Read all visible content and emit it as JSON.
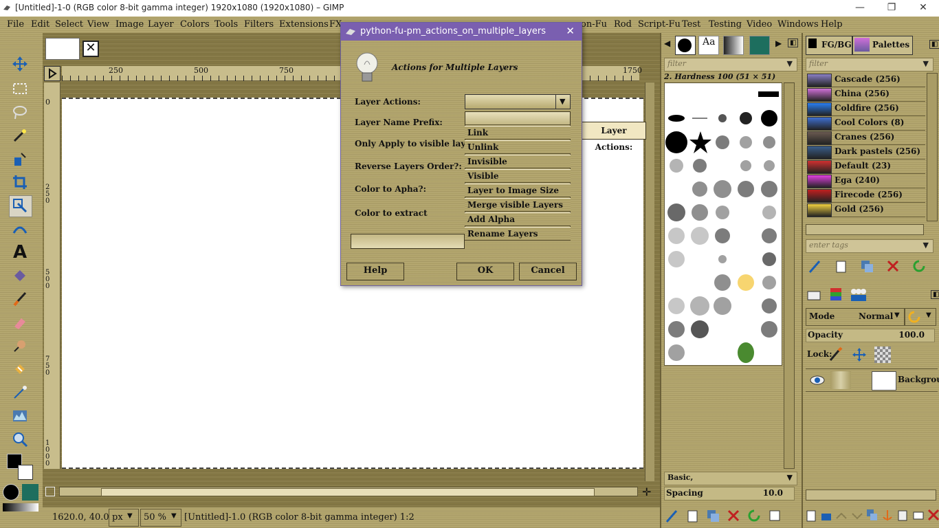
{
  "window": {
    "title": "[Untitled]-1-0 (RGB color 8-bit gamma integer) 1920x1080 (1920x1080) – GIMP",
    "controls": [
      "—",
      "❐",
      "✕"
    ]
  },
  "menubar": [
    "File",
    "Edit",
    "Select",
    "View",
    "Image",
    "Layer",
    "Colors",
    "Tools",
    "Filters",
    "Extensions",
    "FX",
    "on-Fu",
    "Rod",
    "Script-Fu",
    "Test",
    "Testing",
    "Video",
    "Windows",
    "Help"
  ],
  "ruler": {
    "h_ticks": [
      "250",
      "500",
      "750",
      "1750"
    ],
    "v_ticks": [
      "0",
      "250",
      "500",
      "750",
      "1000"
    ]
  },
  "status": {
    "coords": "1620.0, 40.0",
    "unit": "px",
    "zoom": "50 %",
    "info": "[Untitled]-1.0 (RGB color 8-bit gamma integer) 1:2"
  },
  "brushes": {
    "filter_placeholder": "filter",
    "selected": "2. Hardness 100 (51 × 51)",
    "preset": "Basic,",
    "spacing_label": "Spacing",
    "spacing_value": "10.0"
  },
  "palettes": {
    "tab_fgbg": "FG/BG",
    "tab_palettes": "Palettes",
    "filter_placeholder": "filter",
    "tags_placeholder": "enter tags",
    "items": [
      {
        "name": "Cascade (256)",
        "color": "#8a7fc4"
      },
      {
        "name": "China (256)",
        "color": "#d070d8"
      },
      {
        "name": "Coldfire (256)",
        "color": "#2a7ef0"
      },
      {
        "name": "Cool Colors (8)",
        "color": "#3f6fd0"
      },
      {
        "name": "Cranes (256)",
        "color": "#6a5a50"
      },
      {
        "name": "Dark pastels (256)",
        "color": "#3a5d8a"
      },
      {
        "name": "Default (23)",
        "color": "#d03030"
      },
      {
        "name": "Ega (240)",
        "color": "#e040e0"
      },
      {
        "name": "Firecode (256)",
        "color": "#c02020"
      },
      {
        "name": "Gold (256)",
        "color": "#f0d040"
      }
    ]
  },
  "layers": {
    "mode_label": "Mode",
    "mode_value": "Normal",
    "opacity_label": "Opacity",
    "opacity_value": "100.0",
    "lock_label": "Lock:",
    "layer_name": "Background"
  },
  "dialog": {
    "title": "python-fu-pm_actions_on_multiple_layers",
    "heading": "Actions for Multiple Layers",
    "labels": {
      "layer_actions": "Layer Actions:",
      "prefix": "Layer Name Prefix:",
      "visible_only": "Only Apply to visible layers:",
      "reverse": "Reverse Layers Order?:",
      "color_alpha": "Color to Apha?:",
      "color_extract": "Color to extract"
    },
    "dropdown_options": [
      "Link",
      "Unlink",
      "Invisible",
      "Visible",
      "Layer to Image Size",
      "Merge visible Layers",
      "Add Alpha",
      "Rename Layers"
    ],
    "tooltip": "Layer Actions:",
    "buttons": {
      "help": "Help",
      "ok": "OK",
      "cancel": "Cancel"
    }
  }
}
